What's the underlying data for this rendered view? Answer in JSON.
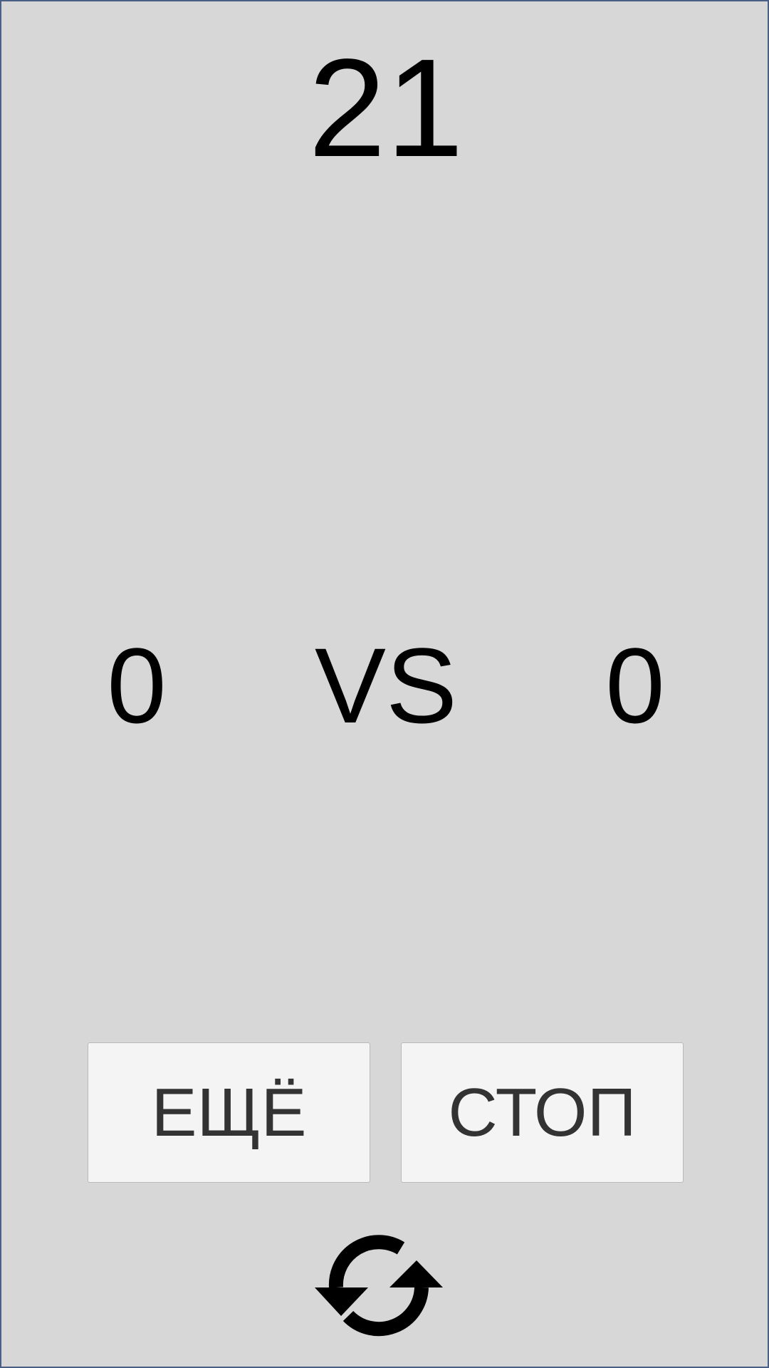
{
  "game": {
    "target": "21",
    "player_score": "0",
    "versus_label": "VS",
    "dealer_score": "0"
  },
  "controls": {
    "more_label": "ЕЩЁ",
    "stop_label": "СТОП",
    "restart_icon": "refresh-icon"
  },
  "colors": {
    "background": "#d7d7d7",
    "button": "#f4f4f4",
    "button_text": "#333333",
    "text": "#000000",
    "frame_border": "#4a5f86"
  }
}
